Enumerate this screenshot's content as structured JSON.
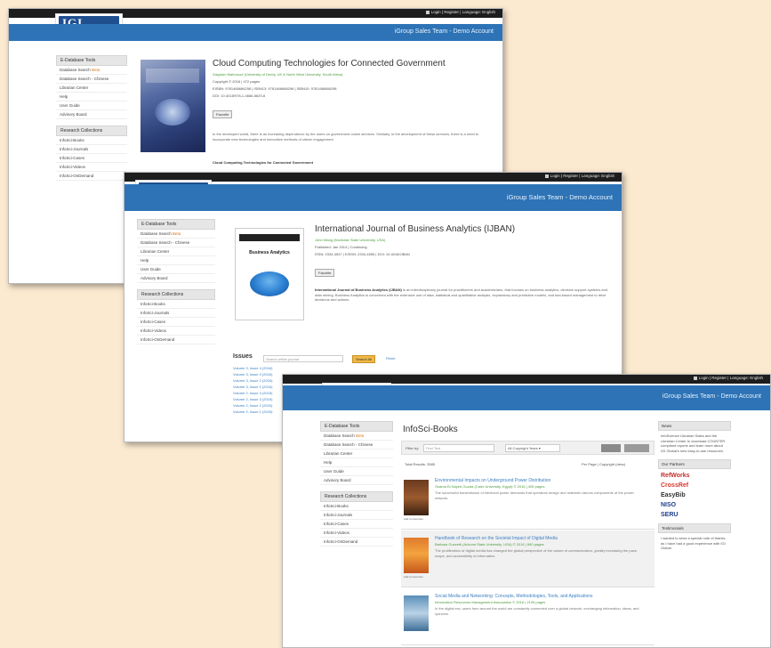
{
  "topbar": {
    "links": "Login  |  Register  |  Language: English"
  },
  "logo": {
    "text": "IGI",
    "tagline": "PUBLISHING & DISSEMINATING"
  },
  "welcome": "iGroup Sales Team - Demo Account",
  "sidebar": {
    "tools_head": "E-Database Tools",
    "tools": [
      "Database Search",
      "Database Search - Chinese",
      "Librarian Center",
      "Help",
      "User Guide",
      "Advisory Board"
    ],
    "collections_head": "Research Collections",
    "collections": [
      "InfoSci-Books",
      "InfoSci-Journals",
      "InfoSci-Cases",
      "InfoSci-Videos",
      "InfoSci-OnDemand"
    ]
  },
  "shot1": {
    "book_title": "Cloud Computing Technologies for Connected Government",
    "editors": "Zaigham Mahmood (University of Derby, UK & North West University, South Africa)",
    "copyright": "Copyright © 2016 | 472 pages",
    "ids": "EISBN: 9781466686298  |  ISBN13: 9781466686298  |  ISBN10: 9781466686298",
    "doi": "DOI: 10.4018/978-1-4666-8629-8",
    "citation_btn": "Favorite",
    "desc": "In the developed world, there is an increasing dependence by the users on government online services. Similarly, in the development of these services, there is a need to incorporate new technologies and innovative methods of citizen engagement.",
    "desc_bold": "Cloud Computing Technologies for Connected Government"
  },
  "shot2": {
    "journal_title": "International Journal of Business Analytics (IJBAN)",
    "editor": "John Wang (Montclair State University, USA)",
    "published": "Published: Jan 2014 | Continuing",
    "ids": "ISSN: 2334-4547  |  EISSN: 2334-4555  |  DOI: 10.4018/IJBAN",
    "citation_btn": "Favorite",
    "desc_bold": "International Journal of Business Analytics (IJBAN)",
    "desc": " is an interdisciplinary journal for practitioners and academicians, that focuses on business analytics, decision support systems and data mining. Business Analytics is concerned with the extensive use of data, statistical and quantitative analysis, explanatory and predictive models, and fact-based management to drive decisions and actions.",
    "issues_head": "Issues",
    "search_placeholder": "Search within journal",
    "go_btn": "Search All",
    "reset": "Reset",
    "issues": [
      "Volume 3, Issue 4 (2016)",
      "Volume 3, Issue 3 (2016)",
      "Volume 3, Issue 2 (2016)",
      "Volume 3, Issue 1 (2016)",
      "Volume 2, Issue 4 (2015)",
      "Volume 2, Issue 3 (2015)",
      "Volume 2, Issue 2 (2015)",
      "Volume 2, Issue 1 (2015)"
    ],
    "cover_title": "Business Analytics"
  },
  "shot3": {
    "page_title": "InfoSci-Books",
    "filter_label": "Filter by:",
    "filter_placeholder": "Find Text",
    "sort_label": "All Copyright Years",
    "results_count": "Total Results: 3585",
    "per_page": "Per Page  |  Copyright (desc)",
    "results": [
      {
        "title": "Environmental Impacts on Underground Power Distribution",
        "sub": "Osama El-Sayed Gouda (Cairo University, Egypt) © 2016 | 405 pages",
        "desc": "The successful transmission of electrical power demands that operators design and maintain various components of the power network.",
        "thumb_label": "Add to Favorites"
      },
      {
        "title": "Handbook of Research on the Societal Impact of Digital Media",
        "sub": "Barbara Guzzetti (Arizona State University, USA) © 2016 | 690 pages",
        "desc": "The proliferation of digital media has changed the global perspective of the nature of communication, greatly increasing the pace, scope, and accessibility of information.",
        "thumb_label": "Add to Favorites"
      },
      {
        "title": "Social Media and Networking: Concepts, Methodologies, Tools, and Applications",
        "sub": "Information Resources Management Association © 2016 | 2109 pages",
        "desc": "In the digital era, users from around the world are constantly connected over a global network, exchanging information, ideas, and opinions.",
        "thumb_label": "Add to Favorites"
      }
    ],
    "news_head": "News",
    "news_text": "InfoScience Librarian Sales and the Librarian Center to download COUNTER compliant reports and learn more about IGI Global's new easy-to-use resources.",
    "partners_head": "Our Partners",
    "partners": [
      "RefWorks",
      "CrossRef",
      "EasyBib",
      "NISO",
      "SERU"
    ],
    "testimonials_head": "Testimonials",
    "testimonials_text": "I wanted to send a special note of thanks as I have had a good experience with IGI Global."
  }
}
